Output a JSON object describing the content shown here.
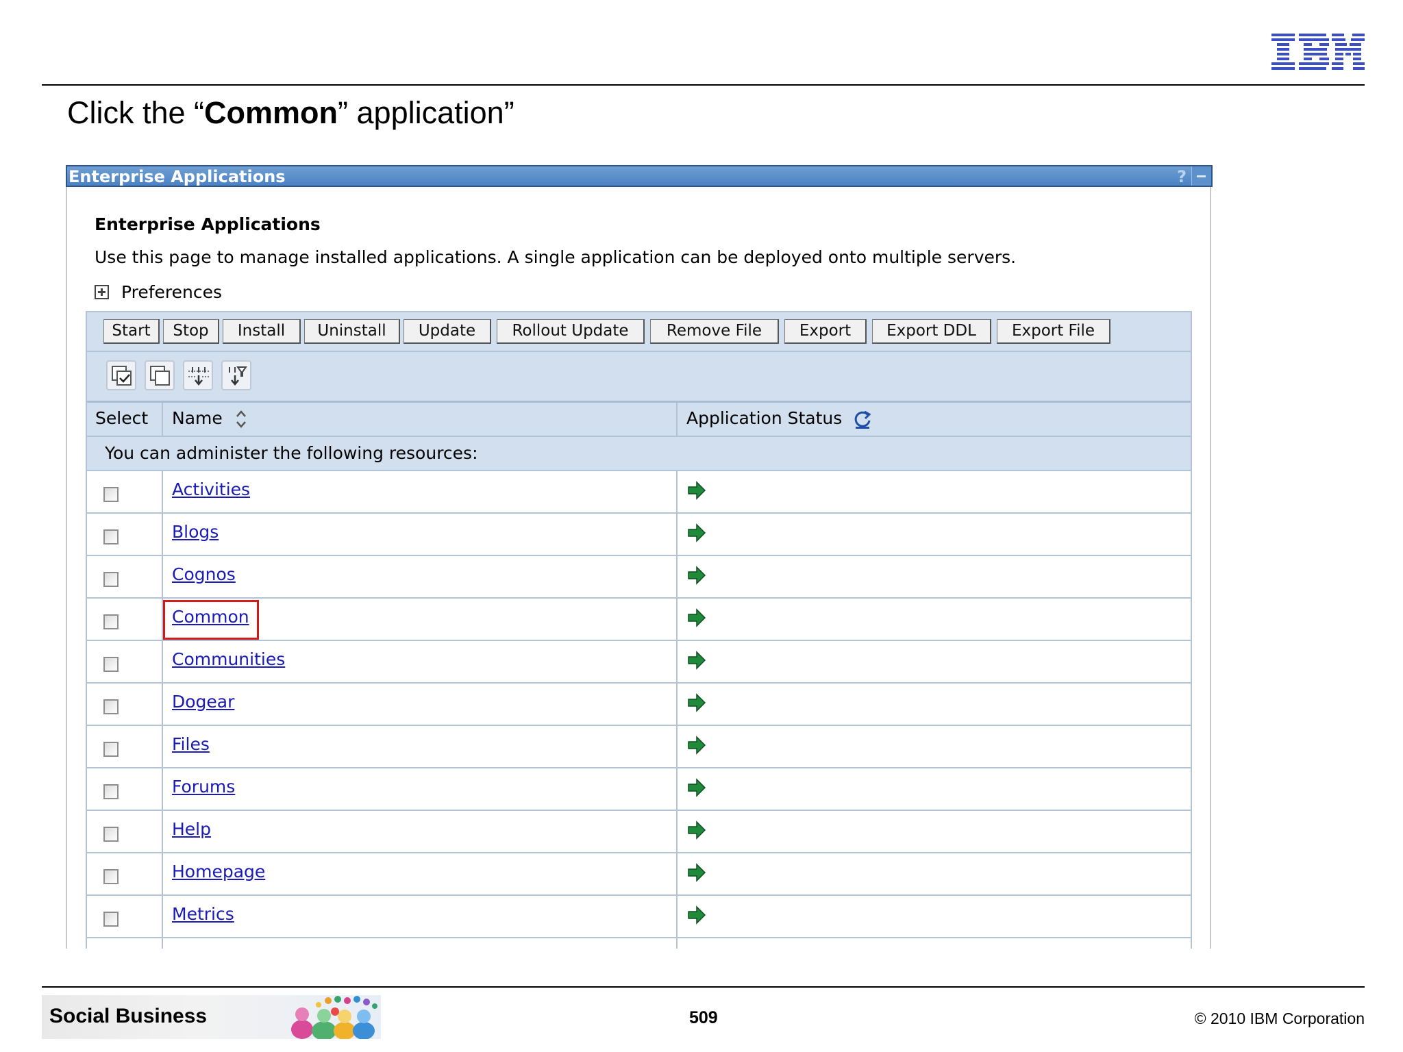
{
  "slide": {
    "logo_text": "IBM",
    "title_before": "Click the “",
    "title_bold": "Common",
    "title_after": "” application”",
    "footer_brand": "Social Business",
    "page_number": "509",
    "copyright": "© 2010 IBM Corporation"
  },
  "console": {
    "portlet_title": "Enterprise Applications",
    "help_label": "?",
    "page_heading": "Enterprise Applications",
    "page_description": "Use this page to manage installed applications. A single application can be deployed onto multiple servers.",
    "preferences_label": "Preferences",
    "buttons": [
      "Start",
      "Stop",
      "Install",
      "Uninstall",
      "Update",
      "Rollout Update",
      "Remove File",
      "Export",
      "Export DDL",
      "Export File"
    ],
    "icon_buttons": [
      "select-all-icon",
      "deselect-all-icon",
      "show-filter-icon",
      "clear-filter-icon"
    ],
    "table": {
      "headers": {
        "select": "Select",
        "name": "Name",
        "status": "Application Status"
      },
      "admin_notice": "You can administer the following resources:",
      "rows": [
        {
          "name": "Activities",
          "status": "running"
        },
        {
          "name": "Blogs",
          "status": "running"
        },
        {
          "name": "Cognos",
          "status": "running"
        },
        {
          "name": "Common",
          "status": "running"
        },
        {
          "name": "Communities",
          "status": "running"
        },
        {
          "name": "Dogear",
          "status": "running"
        },
        {
          "name": "Files",
          "status": "running"
        },
        {
          "name": "Forums",
          "status": "running"
        },
        {
          "name": "Help",
          "status": "running"
        },
        {
          "name": "Homepage",
          "status": "running"
        },
        {
          "name": "Metrics",
          "status": "running"
        }
      ],
      "highlighted_row": "Common"
    },
    "colors": {
      "title_bar": "#4a82c4",
      "table_header_bg": "#d2dfee",
      "link": "#1a1ab8",
      "highlight": "#d11a1a",
      "status_green": "#1f8a3a"
    }
  }
}
